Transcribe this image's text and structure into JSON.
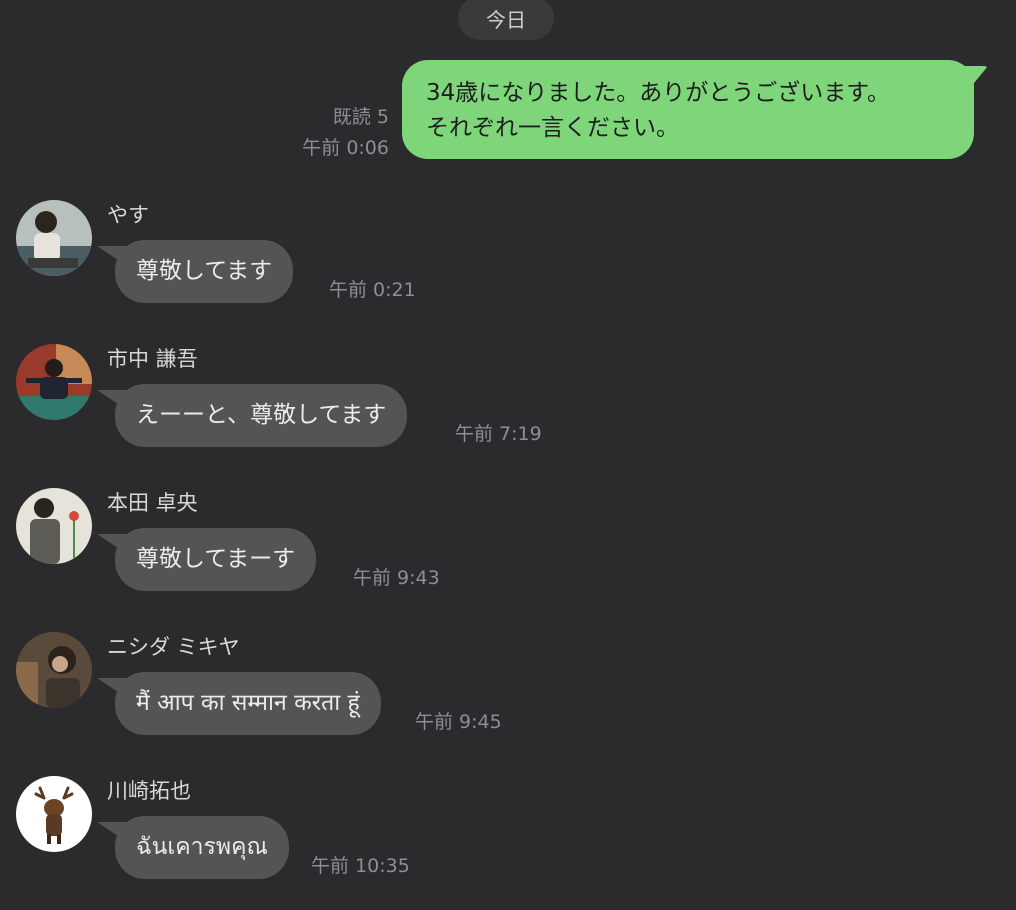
{
  "date_separator": "今日",
  "outgoing": {
    "read_receipt": "既読 5",
    "time": "午前 0:06",
    "text": "34歳になりました。ありがとうございます。\nそれぞれ一言ください。",
    "bubble_color": "#7fd67a"
  },
  "messages": [
    {
      "sender": "やす",
      "text": "尊敬してます",
      "time": "午前 0:21",
      "avatar_icon": "person-avatar"
    },
    {
      "sender": "市中 謙吾",
      "text": "えーーと、尊敬してます",
      "time": "午前 7:19",
      "avatar_icon": "person-avatar"
    },
    {
      "sender": "本田 卓央",
      "text": "尊敬してまーす",
      "time": "午前 9:43",
      "avatar_icon": "person-avatar"
    },
    {
      "sender": "ニシダ ミキヤ",
      "text": "मैं आप का सम्मान करता हूं",
      "time": "午前 9:45",
      "avatar_icon": "person-avatar"
    },
    {
      "sender": "川崎拓也",
      "text": "ฉันเคารพคุณ",
      "time": "午前 10:35",
      "avatar_icon": "deer-figure-avatar"
    }
  ],
  "colors": {
    "background": "#2b2b2d",
    "incoming_bubble": "#545456",
    "outgoing_bubble": "#7fd67a"
  }
}
